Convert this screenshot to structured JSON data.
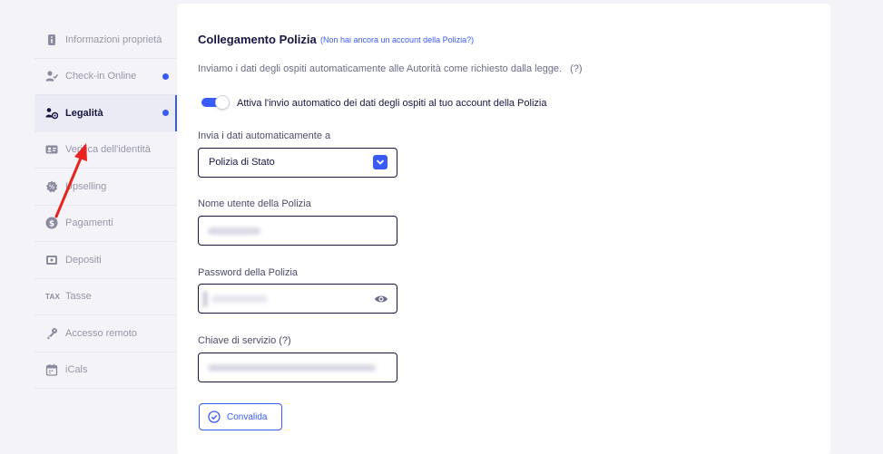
{
  "sidebar": {
    "items": [
      {
        "label": "Informazioni proprietà",
        "icon": "info-icon"
      },
      {
        "label": "Check-in Online",
        "icon": "user-check-icon",
        "has_dot": true
      },
      {
        "label": "Legalità",
        "icon": "legal-icon",
        "has_dot": true,
        "active": true
      },
      {
        "label": "Verifica dell'identità",
        "icon": "id-card-icon"
      },
      {
        "label": "Upselling",
        "icon": "percent-badge-icon"
      },
      {
        "label": "Pagamenti",
        "icon": "dollar-icon"
      },
      {
        "label": "Depositi",
        "icon": "deposit-icon"
      },
      {
        "label": "Tasse",
        "icon": "tax-icon",
        "icon_text": "TAX"
      },
      {
        "label": "Accesso remoto",
        "icon": "key-icon"
      },
      {
        "label": "iCals",
        "icon": "calendar-icon"
      }
    ]
  },
  "main": {
    "title": "Collegamento Polizia",
    "title_link": "(Non hai ancora un account della Polizia?)",
    "info_text": "Inviamo i dati degli ospiti automaticamente alle Autorità come richiesto dalla legge.",
    "info_help": "(?)",
    "toggle_label": "Attiva l'invio automatico dei dati degli ospiti al tuo account della Polizia",
    "toggle_on": true,
    "send_to_label": "Invia i dati automaticamente a",
    "send_to_value": "Polizia di Stato",
    "username_label": "Nome utente della Polizia",
    "password_label": "Password della Polizia",
    "service_key_label": "Chiave di servizio (?)",
    "validate_button": "Convalida"
  },
  "colors": {
    "accent": "#385bf8",
    "annotation_arrow": "#e8231f",
    "text_dark": "#161643",
    "text_muted": "#9696ab"
  }
}
